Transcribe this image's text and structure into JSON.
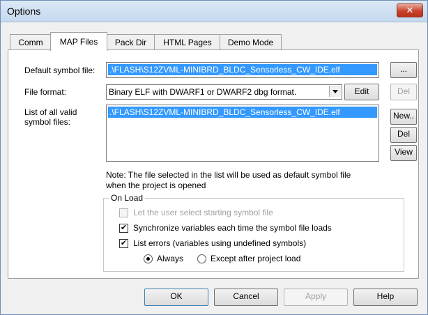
{
  "window": {
    "title": "Options",
    "close_glyph": "✕"
  },
  "tabs": [
    {
      "label": "Comm",
      "active": false
    },
    {
      "label": "MAP Files",
      "active": true
    },
    {
      "label": "Pack Dir",
      "active": false
    },
    {
      "label": "HTML Pages",
      "active": false
    },
    {
      "label": "Demo Mode",
      "active": false
    }
  ],
  "default_symbol": {
    "label": "Default symbol file:",
    "value": ".\\FLASH\\S12ZVML-MINIBRD_BLDC_Sensorless_CW_IDE.elf",
    "browse_label": "..."
  },
  "file_format": {
    "label": "File format:",
    "value": "Binary ELF with DWARF1 or DWARF2 dbg format.",
    "edit_label": "Edit",
    "del_label": "Del"
  },
  "symbol_list": {
    "label_line1": "List of all valid",
    "label_line2": "symbol files:",
    "items": [
      ".\\FLASH\\S12ZVML-MINIBRD_BLDC_Sensorless_CW_IDE.elf"
    ],
    "new_label": "New..",
    "del_label": "Del",
    "view_label": "View"
  },
  "note": {
    "line1": "Note: The file selected in the list will be used as default symbol file",
    "line2": "when the project is opened"
  },
  "on_load": {
    "title": "On Load",
    "let_user_select": {
      "label": "Let the user select starting symbol file",
      "checked": false,
      "enabled": false
    },
    "synchronize": {
      "label": "Synchronize variables each time the symbol file loads",
      "checked": true
    },
    "list_errors": {
      "label": "List errors (variables using undefined symbols)",
      "checked": true
    },
    "radio_always": {
      "label": "Always",
      "selected": true
    },
    "radio_except": {
      "label": "Except after project load",
      "selected": false
    }
  },
  "footer": {
    "ok": "OK",
    "cancel": "Cancel",
    "apply": "Apply",
    "help": "Help"
  }
}
